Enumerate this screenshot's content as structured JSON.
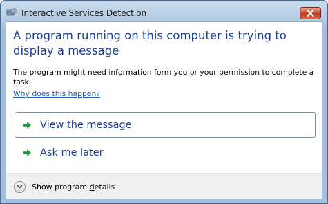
{
  "window": {
    "title": "Interactive Services Detection"
  },
  "dialog": {
    "heading": "A program running on this computer is trying to display a message",
    "description": "The program might need information form you or your permission to complete a task.",
    "why_link": "Why does this happen?"
  },
  "commands": [
    {
      "label": "View the message",
      "icon": "green-arrow-icon"
    },
    {
      "label": "Ask me later",
      "icon": "green-arrow-icon"
    }
  ],
  "footer": {
    "details_prefix": "Show program ",
    "details_underlined": "d",
    "details_suffix": "etails"
  },
  "colors": {
    "heading": "#1e3f91",
    "link": "#1f5fb8",
    "arrow": "#1f9a3a",
    "close": "#c23a1f"
  }
}
